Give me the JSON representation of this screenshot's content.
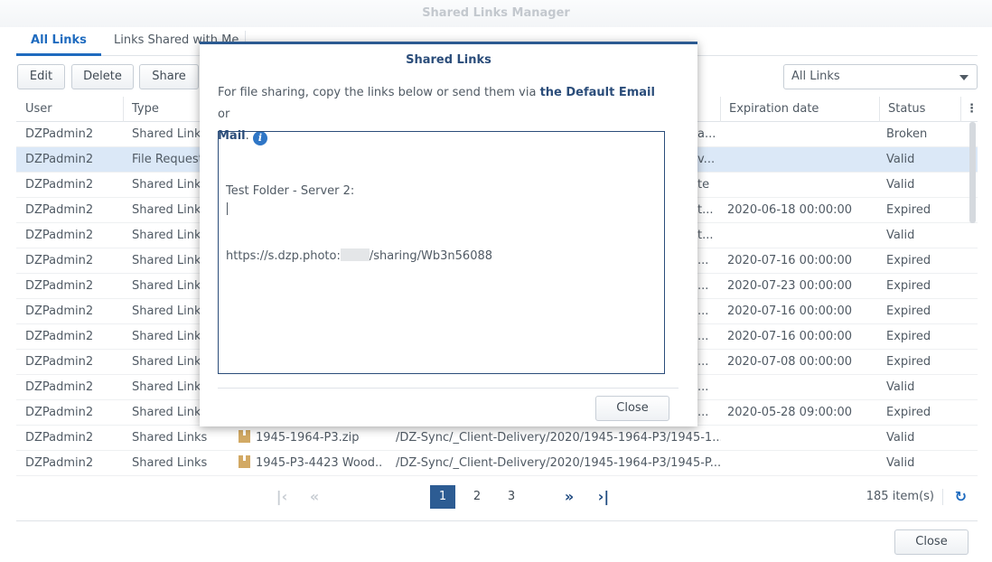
{
  "window": {
    "title": "Shared Links Manager"
  },
  "tabs": [
    {
      "label": "All Links"
    },
    {
      "label": "Links Shared with Me"
    }
  ],
  "toolbar": {
    "edit": "Edit",
    "delete": "Delete",
    "share": "Share"
  },
  "filter": {
    "selected": "All Links"
  },
  "columns": {
    "user": "User",
    "type": "Type",
    "expiration": "Expiration date",
    "status": "Status"
  },
  "rows": [
    {
      "user": "DZPadmin2",
      "type": "Shared Links",
      "name": "",
      "path_tail": "a...",
      "expiration": "",
      "status": "Broken"
    },
    {
      "user": "DZPadmin2",
      "type": "File Request",
      "name": "",
      "path_tail": "v...",
      "expiration": "",
      "status": "Valid"
    },
    {
      "user": "DZPadmin2",
      "type": "Shared Links",
      "name": "",
      "path_tail": "te",
      "expiration": "",
      "status": "Valid"
    },
    {
      "user": "DZPadmin2",
      "type": "Shared Links",
      "name": "",
      "path_tail": "t...",
      "expiration": "2020-06-18 00:00:00",
      "status": "Expired"
    },
    {
      "user": "DZPadmin2",
      "type": "Shared Links",
      "name": "",
      "path_tail": "t...",
      "expiration": "",
      "status": "Valid"
    },
    {
      "user": "DZPadmin2",
      "type": "Shared Links",
      "name": "",
      "path_tail": "...",
      "expiration": "2020-07-16 00:00:00",
      "status": "Expired"
    },
    {
      "user": "DZPadmin2",
      "type": "Shared Links",
      "name": "",
      "path_tail": "...",
      "expiration": "2020-07-23 00:00:00",
      "status": "Expired"
    },
    {
      "user": "DZPadmin2",
      "type": "Shared Links",
      "name": "",
      "path_tail": "...",
      "expiration": "2020-07-16 00:00:00",
      "status": "Expired"
    },
    {
      "user": "DZPadmin2",
      "type": "Shared Links",
      "name": "",
      "path_tail": "...",
      "expiration": "2020-07-16 00:00:00",
      "status": "Expired"
    },
    {
      "user": "DZPadmin2",
      "type": "Shared Links",
      "name": "",
      "path_tail": "...",
      "expiration": "2020-07-08 00:00:00",
      "status": "Expired"
    },
    {
      "user": "DZPadmin2",
      "type": "Shared Links",
      "name": "",
      "path_tail": "...",
      "expiration": "",
      "status": "Valid"
    },
    {
      "user": "DZPadmin2",
      "type": "Shared Links",
      "name": "",
      "path_tail": "...",
      "expiration": "2020-05-28 09:00:00",
      "status": "Expired"
    },
    {
      "user": "DZPadmin2",
      "type": "Shared Links",
      "name": "1945-1964-P3.zip",
      "path": "/DZ-Sync/_Client-Delivery/2020/1945-1964-P3/1945-1...",
      "expiration": "",
      "status": "Valid"
    },
    {
      "user": "DZPadmin2",
      "type": "Shared Links",
      "name": "1945-P3-4423 Wood...",
      "path": "/DZ-Sync/_Client-Delivery/2020/1945-1964-P3/1945-P...",
      "expiration": "",
      "status": "Valid"
    }
  ],
  "pager": {
    "pages": [
      "1",
      "2",
      "3"
    ],
    "current": "1",
    "count": "185 item(s)",
    "first": "|‹",
    "prev": "«",
    "next": "»",
    "last": "›|"
  },
  "footer": {
    "close": "Close"
  },
  "modal": {
    "title": "Shared Links",
    "desc_prefix": "For file sharing, copy the links below or send them via ",
    "desc_link_email": "the Default Email",
    "desc_or": " or",
    "desc_link_mail": "Mail",
    "desc_period": ".",
    "text_line1": "Test Folder - Server 2:",
    "text_url_prefix": "https://s.dzp.photo:",
    "text_url_suffix": "/sharing/Wb3n56088",
    "close": "Close"
  },
  "colors": {
    "accent": "#1f6bbf",
    "modal_border": "#2b5a91",
    "selected_row": "#dbe8f7"
  }
}
